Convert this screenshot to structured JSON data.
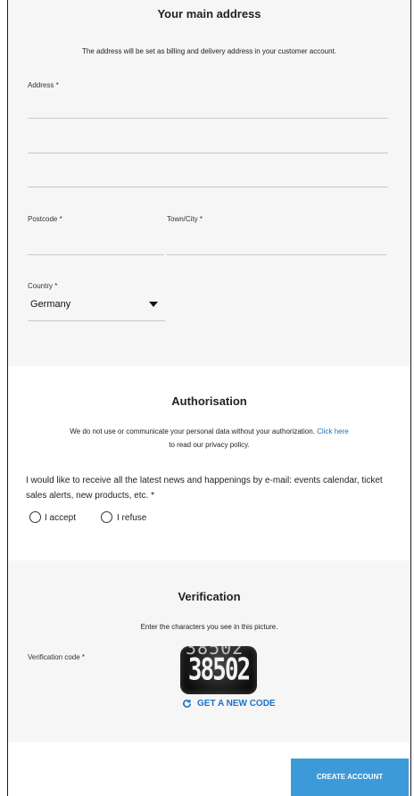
{
  "address_section": {
    "title": "Your main address",
    "subtitle": "The address will be set as billing and delivery address in your customer account.",
    "address_label": "Address *",
    "postcode_label": "Postcode *",
    "town_label": "Town/City *",
    "country_label": "Country *",
    "country_value": "Germany"
  },
  "authorisation_section": {
    "title": "Authorisation",
    "privacy_text": "We do not use or communicate your personal data without your authorization.",
    "privacy_link": "Click here",
    "privacy_text2": "to read our privacy policy.",
    "newsletter_text": "I would like to receive all the latest news and happenings by e-mail: events calendar, ticket sales alerts, new products, etc. *",
    "accept_label": "I accept",
    "refuse_label": "I refuse"
  },
  "verification_section": {
    "title": "Verification",
    "instructions": "Enter the characters you see in this picture.",
    "code_label": "Verification code *",
    "captcha_text": "38502",
    "new_code_label": "GET A NEW CODE"
  },
  "footer": {
    "create_account_label": "CREATE ACCOUNT"
  },
  "colors": {
    "accent": "#3d9ad9",
    "link": "#1a73c8",
    "section_grey": "#f6f6f6"
  },
  "icons": {
    "refresh": "refresh-icon",
    "dropdown": "caret-down-icon"
  }
}
